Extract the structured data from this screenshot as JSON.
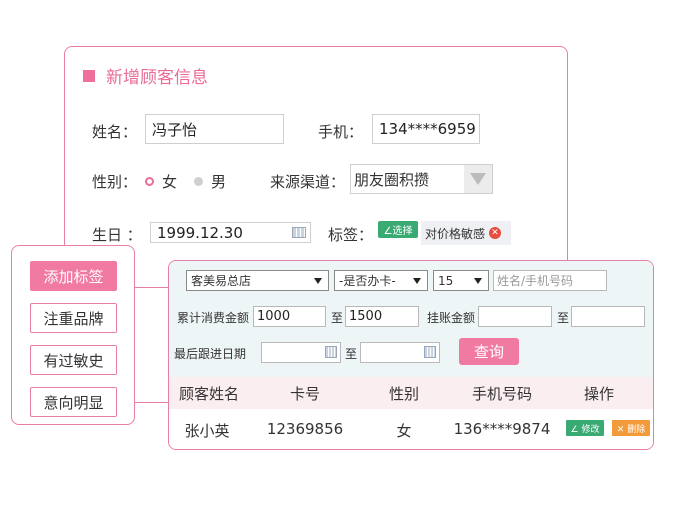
{
  "form": {
    "title": "新增顾客信息",
    "name_label": "姓名：",
    "name_value": "冯子怡",
    "phone_label": "手机：",
    "phone_value": "134****6959",
    "gender_label": "性别：",
    "gender_female": "女",
    "gender_male": "男",
    "gender_selected": "女",
    "source_label": "来源渠道：",
    "source_value": "朋友圈积攒",
    "birthday_label": "生日 ：",
    "birthday_value": "1999.12.30",
    "tag_label": "标签：",
    "choose_label": "∠选择",
    "tag_chip": "对价格敏感",
    "tag_remove_glyph": "✕"
  },
  "tag_panel": {
    "items": [
      "添加标签",
      "注重品牌",
      "有过敏史",
      "意向明显"
    ],
    "active_index": 0
  },
  "query": {
    "store_select": "客美易总店",
    "card_select": "-是否办卡-",
    "page_size_select": "15",
    "search_placeholder": "姓名/手机号码",
    "total_spend_label": "累计消费金额",
    "spend_from": "1000",
    "to_label": "至",
    "spend_to": "1500",
    "credit_label": "挂账金额",
    "credit_from": "",
    "credit_to": "",
    "last_follow_label": "最后跟进日期",
    "date_from": "",
    "date_to": "",
    "query_button": "查询"
  },
  "table": {
    "headers": [
      "顾客姓名",
      "卡号",
      "性别",
      "手机号码",
      "操作"
    ],
    "rows": [
      {
        "name": "张小英",
        "card": "12369856",
        "gender": "女",
        "phone": "136****9874",
        "edit": "∠ 修改",
        "delete": "✕ 删除"
      }
    ]
  },
  "colors": {
    "accent_pink": "#f07aa2",
    "border_pink": "#e87fa3",
    "green": "#3aaa73",
    "orange": "#f39a3a"
  }
}
